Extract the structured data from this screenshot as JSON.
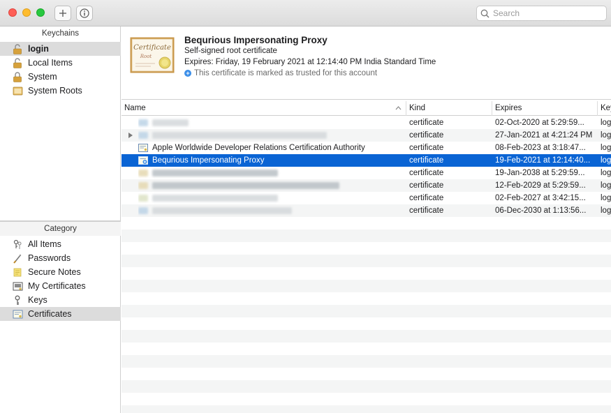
{
  "toolbar": {
    "add_button": "+",
    "info_button": "i",
    "search_placeholder": "Search"
  },
  "sidebar": {
    "keychains_header": "Keychains",
    "keychains": [
      {
        "label": "login",
        "icon": "lock-open-icon",
        "selected": true
      },
      {
        "label": "Local Items",
        "icon": "lock-open-icon"
      },
      {
        "label": "System",
        "icon": "lock-icon"
      },
      {
        "label": "System Roots",
        "icon": "folder-icon"
      }
    ],
    "category_header": "Category",
    "categories": [
      {
        "label": "All Items",
        "icon": "all-items-icon"
      },
      {
        "label": "Passwords",
        "icon": "password-icon"
      },
      {
        "label": "Secure Notes",
        "icon": "note-icon"
      },
      {
        "label": "My Certificates",
        "icon": "my-certificate-icon"
      },
      {
        "label": "Keys",
        "icon": "key-icon"
      },
      {
        "label": "Certificates",
        "icon": "certificate-icon",
        "selected": true
      }
    ]
  },
  "detail": {
    "title": "Bequrious Impersonating Proxy",
    "subtitle": "Self-signed root certificate",
    "expires": "Expires: Friday, 19 February 2021 at 12:14:40 PM India Standard Time",
    "trust": "This certificate is marked as trusted for this account",
    "badge": {
      "line1": "Certificate",
      "line2": "Root"
    }
  },
  "table": {
    "columns": {
      "name": "Name",
      "kind": "Kind",
      "expires": "Expires",
      "keychain": "Key"
    },
    "rows": [
      {
        "name": "",
        "kind": "certificate",
        "expires": "02-Oct-2020 at 5:29:59...",
        "keychain": "log",
        "blurred": true
      },
      {
        "name": "",
        "kind": "certificate",
        "expires": "27-Jan-2021 at 4:21:24 PM",
        "keychain": "log",
        "blurred": true,
        "disclosure": true
      },
      {
        "name": "Apple Worldwide Developer Relations Certification Authority",
        "kind": "certificate",
        "expires": "08-Feb-2023 at 3:18:47...",
        "keychain": "log"
      },
      {
        "name": "Bequrious Impersonating Proxy",
        "kind": "certificate",
        "expires": "19-Feb-2021 at 12:14:40...",
        "keychain": "log",
        "selected": true
      },
      {
        "name": "",
        "kind": "certificate",
        "expires": "19-Jan-2038 at 5:29:59...",
        "keychain": "log",
        "blurred": true
      },
      {
        "name": "",
        "kind": "certificate",
        "expires": "12-Feb-2029 at 5:29:59...",
        "keychain": "log",
        "blurred": true
      },
      {
        "name": "",
        "kind": "certificate",
        "expires": "02-Feb-2027 at 3:42:15...",
        "keychain": "log",
        "blurred": true
      },
      {
        "name": "",
        "kind": "certificate",
        "expires": "06-Dec-2030 at 1:13:56...",
        "keychain": "log",
        "blurred": true
      }
    ]
  },
  "colors": {
    "selection": "#0a64d4",
    "sidebar_selection": "#dcdcdc",
    "row_alt": "#f4f5f5",
    "trust_badge": "#3b8ee8"
  }
}
